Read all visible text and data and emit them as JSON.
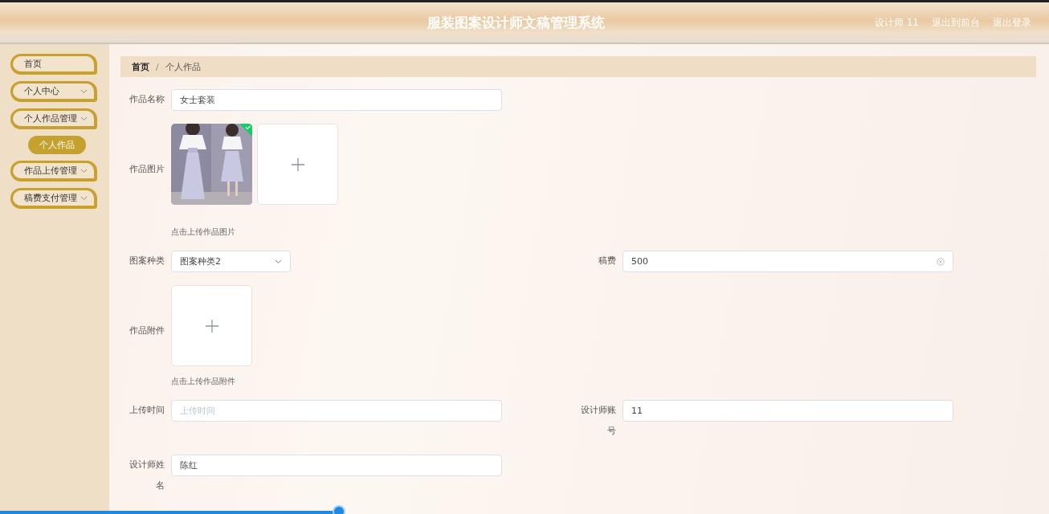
{
  "header": {
    "title": "服装图案设计师文稿管理系统",
    "links": [
      {
        "label": "设计师 11"
      },
      {
        "label": "退出到前台"
      },
      {
        "label": "退出登录"
      }
    ]
  },
  "sidebar": {
    "items": [
      {
        "label": "首页",
        "kind": "link"
      },
      {
        "label": "个人中心",
        "kind": "menu"
      },
      {
        "label": "个人作品管理",
        "kind": "menu",
        "children": [
          {
            "label": "个人作品",
            "selected": true
          }
        ]
      },
      {
        "label": "作品上传管理",
        "kind": "menu"
      },
      {
        "label": "稿费支付管理",
        "kind": "menu"
      }
    ]
  },
  "breadcrumb": {
    "separator": "/",
    "items": [
      "首页",
      "个人作品"
    ]
  },
  "form": {
    "rows": [
      [
        {
          "kind": "text",
          "label": "作品名称",
          "value": "女士套装"
        }
      ],
      [
        {
          "kind": "image_upload",
          "label": "作品图片",
          "images": [
            {
              "kind": "picture",
              "uploaded": true
            }
          ],
          "hint": "点击上传作品图片"
        }
      ],
      [
        {
          "kind": "select",
          "label": "图案种类",
          "value": "图案种类2"
        },
        {
          "kind": "text",
          "label": "稿费",
          "value": "500",
          "clearable": true
        }
      ],
      [
        {
          "kind": "file_upload",
          "label": "作品附件",
          "hint": "点击上传作品附件"
        }
      ],
      [
        {
          "kind": "text",
          "label": "上传时间",
          "placeholder": "上传时间"
        },
        {
          "kind": "text",
          "label": "设计师账号",
          "value": "11"
        }
      ],
      [
        {
          "kind": "text",
          "label": "设计师姓名",
          "value": "陈红"
        }
      ]
    ]
  },
  "playback_bar": {
    "level": 0.323
  }
}
